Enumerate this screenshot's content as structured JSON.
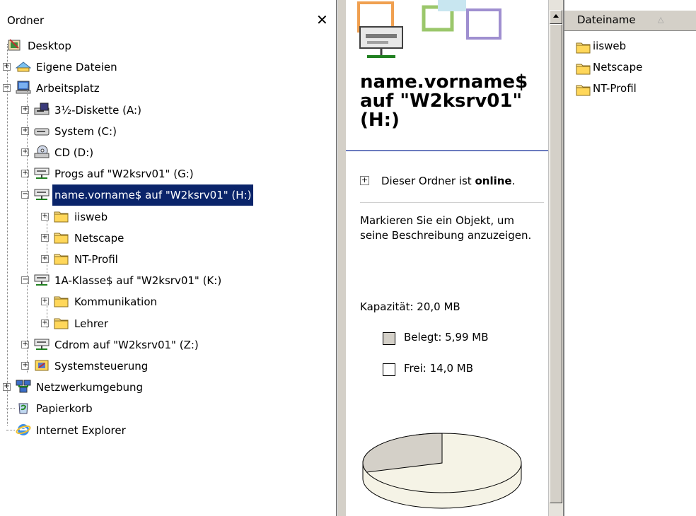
{
  "tree": {
    "title": "Ordner",
    "close_symbol": "✕",
    "items": [
      {
        "label": "Desktop",
        "icon": "desktop-icon"
      },
      {
        "label": "Eigene Dateien",
        "icon": "my-documents-icon"
      },
      {
        "label": "Arbeitsplatz",
        "icon": "my-computer-icon"
      },
      {
        "label": "3½-Diskette (A:)",
        "icon": "floppy-drive-icon"
      },
      {
        "label": "System (C:)",
        "icon": "hard-drive-icon"
      },
      {
        "label": "CD (D:)",
        "icon": "cd-drive-icon"
      },
      {
        "label": "Progs auf \"W2ksrv01\" (G:)",
        "icon": "network-drive-icon"
      },
      {
        "label": "name.vorname$ auf \"W2ksrv01\" (H:)",
        "icon": "network-drive-icon",
        "selected": true
      },
      {
        "label": "iisweb",
        "icon": "folder-icon"
      },
      {
        "label": "Netscape",
        "icon": "folder-icon"
      },
      {
        "label": "NT-Profil",
        "icon": "folder-icon"
      },
      {
        "label": "1A-Klasse$ auf \"W2ksrv01\" (K:)",
        "icon": "network-drive-icon"
      },
      {
        "label": "Kommunikation",
        "icon": "folder-icon"
      },
      {
        "label": "Lehrer",
        "icon": "folder-icon"
      },
      {
        "label": "Cdrom auf \"W2ksrv01\" (Z:)",
        "icon": "network-drive-icon"
      },
      {
        "label": "Systemsteuerung",
        "icon": "control-panel-icon"
      },
      {
        "label": "Netzwerkumgebung",
        "icon": "network-places-icon"
      },
      {
        "label": "Papierkorb",
        "icon": "recycle-bin-icon"
      },
      {
        "label": "Internet Explorer",
        "icon": "internet-explorer-icon"
      }
    ]
  },
  "info": {
    "title": "name.vorname$ auf \"W2ksrv01\" (H:)",
    "online_prefix": "Dieser Ordner ist ",
    "online_status": "online",
    "online_suffix": ".",
    "description": "Markieren Sie ein Objekt, um seine Beschreibung anzuzeigen.",
    "capacity": "Kapazität: 20,0 MB",
    "used": "Belegt: 5,99 MB",
    "free": "Frei: 14,0 MB",
    "used_color": "#d4d0c8",
    "free_color": "#f5f3e6"
  },
  "usage_fraction": 0.3,
  "list": {
    "column_header": "Dateiname",
    "sort_symbol": "△",
    "items": [
      "iisweb",
      "Netscape",
      "NT-Profil"
    ]
  },
  "colors": {
    "selection": "#0a246a",
    "folder": "#ffe48a",
    "window_bg": "#d4d0c8"
  }
}
